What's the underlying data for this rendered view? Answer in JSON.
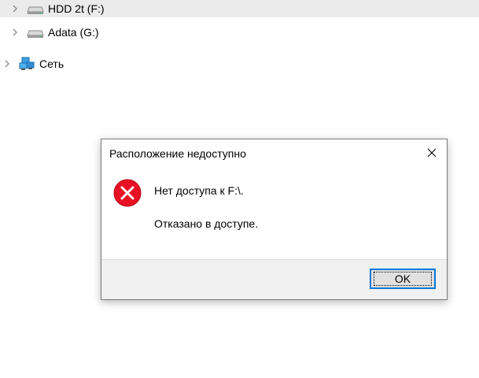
{
  "tree": {
    "drive1": {
      "label": "HDD 2t (F:)",
      "icon": "drive-icon"
    },
    "drive2": {
      "label": "Adata (G:)",
      "icon": "drive-icon"
    },
    "network": {
      "label": "Сеть",
      "icon": "network-icon"
    }
  },
  "dialog": {
    "title": "Расположение недоступно",
    "message": "Нет доступа к F:\\.",
    "detail": "Отказано в доступе.",
    "ok_label": "OK",
    "icon": "error-icon",
    "colors": {
      "error": "#e81123",
      "accent": "#0078d7"
    }
  }
}
